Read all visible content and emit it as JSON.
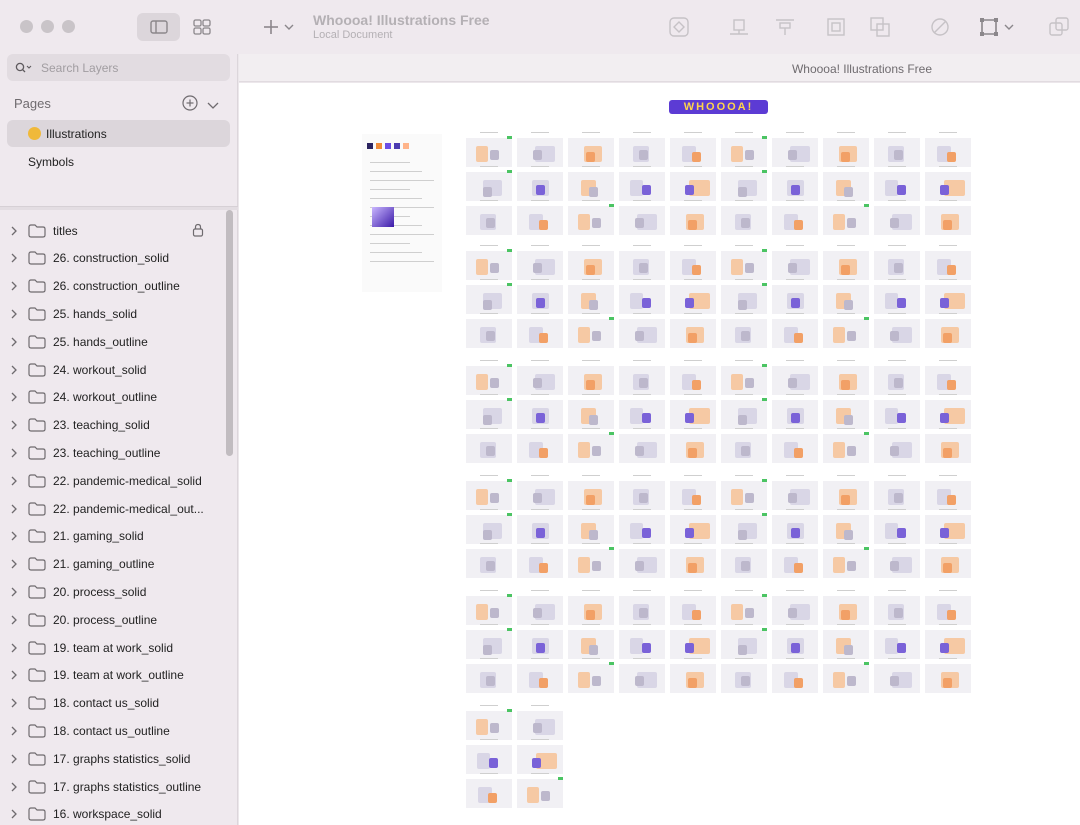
{
  "window": {
    "title": "Whoooa! Illustrations Free",
    "subtitle": "Local Document"
  },
  "icons": {
    "view_canvas": "canvas-view-icon",
    "view_grid": "grid-view-icon",
    "insert": "plus-icon",
    "insert_menu": "chevron-down-icon",
    "symbol": "symbol-icon",
    "align_bottom": "align-bottom-icon",
    "distribute": "distribute-icon",
    "scale": "scale-icon",
    "boolean": "boolean-icon",
    "slash": "slash-icon",
    "resize": "resize-icon",
    "overlay": "overlay-icon"
  },
  "search": {
    "placeholder": "Search Layers"
  },
  "pages": {
    "header": "Pages",
    "items": [
      {
        "label": "Illustrations",
        "emoji": "star-struck-emoji"
      },
      {
        "label": "Symbols"
      }
    ]
  },
  "layers": [
    "titles",
    "26. construction_solid",
    "26. construction_outline",
    "25. hands_solid",
    "25. hands_outline",
    "24. workout_solid",
    "24. workout_outline",
    "23. teaching_solid",
    "23. teaching_outline",
    "22. pandemic-medical_solid",
    "22. pandemic-medical_out...",
    "21. gaming_solid",
    "21. gaming_outline",
    "20. process_solid",
    "20. process_outline",
    "19. team at work_solid",
    "19. team at work_outline",
    "18. contact us_solid",
    "18. contact us_outline",
    "17. graphs statistics_solid",
    "17. graphs statistics_outline",
    "16. workspace_solid"
  ],
  "canvas": {
    "title": "Whoooa! Illustrations Free",
    "logo_text": "WHOOOA!"
  },
  "colors": {
    "accent_purple": "#5c3bd4",
    "accent_orange": "#f08c3a",
    "tag_green": "#4bc463",
    "sidebar_bg": "#efe9ee"
  }
}
